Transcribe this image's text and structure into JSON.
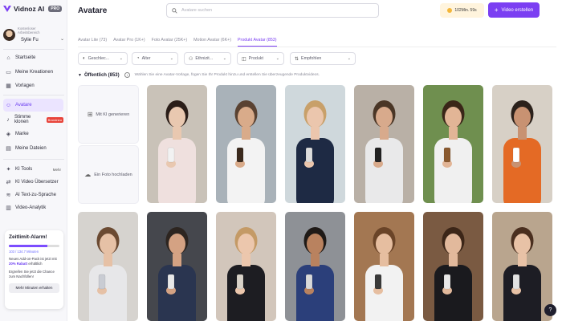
{
  "app": {
    "name": "Vidnoz AI",
    "plan_badge": "PRO"
  },
  "workspace": {
    "label": "Kostenloser Arbeitsbereich",
    "user_name": "Sylie Fu"
  },
  "sidebar": {
    "items": [
      {
        "label": "Startseite",
        "icon": "home-icon"
      },
      {
        "label": "Meine Kreationen",
        "icon": "folder-icon"
      },
      {
        "label": "Vorlagen",
        "icon": "template-icon"
      },
      {
        "label": "Avatare",
        "icon": "avatar-icon",
        "active": true
      },
      {
        "label": "Stimme klonen",
        "icon": "voice-icon",
        "badge": "Brandneu"
      },
      {
        "label": "Marke",
        "icon": "brand-icon"
      },
      {
        "label": "Meine Dateien",
        "icon": "files-icon"
      },
      {
        "label": "KI Tools",
        "icon": "ai-tools-icon",
        "extra": "Mehr"
      },
      {
        "label": "KI Video Übersetzer",
        "icon": "translate-icon"
      },
      {
        "label": "AI Text-zu-Sprache",
        "icon": "tts-icon"
      },
      {
        "label": "Video-Analytik",
        "icon": "analytics-icon"
      }
    ]
  },
  "promo": {
    "title": "Zeitlimit-Alarm!",
    "minutes": "103 / 134.7 Minuten",
    "progress": 0.765,
    "text_pre": "Neues Add-on-Pack ist jetzt mit ",
    "text_highlight": "20% Rabatt",
    "text_post": " erhältlich",
    "text2": "Ergreifen Sie jetzt die Chance zum Nachfüllen!",
    "button": "Mehr Minuten erhalten"
  },
  "header": {
    "title": "Avatare",
    "search_placeholder": "Avatare suchen",
    "credits": "102Min. 59s",
    "create_button": "Video erstellen"
  },
  "tabs": [
    {
      "label": "Avatar Lite (73)"
    },
    {
      "label": "Avatar Pro (1K+)"
    },
    {
      "label": "Foto Avatar (25K+)"
    },
    {
      "label": "Motion Avatar (6K+)"
    },
    {
      "label": "Produkt Avatar (853)",
      "active": true
    }
  ],
  "filters": {
    "gender": "Geschlec...",
    "age": "Alter",
    "ethnicity": "Ethnizit...",
    "product": "Produkt",
    "sort": "Empfohlen"
  },
  "section": {
    "title": "Öffentlich (853)",
    "description": "Wählen Sie eine Avatar-Vorlage, fügen Sie Ihr Produkt hinzu und erstellen Sie überzeugende Produktvideos."
  },
  "actions": {
    "generate": "Mit KI generieren",
    "upload": "Ein Foto hochladen"
  },
  "colors": {
    "accent": "#7b3ff2",
    "active_bg": "#ebe4ff"
  },
  "avatars": [
    {
      "name": "woman-lotion-bathrobe",
      "bg": "#c9c2b8",
      "skin": "#e9c8b0",
      "hair": "#2a1d18",
      "cloth": "#efe0de",
      "prop": "#f2f2f2"
    },
    {
      "name": "man-labcoat-jar",
      "bg": "#a9b2b9",
      "skin": "#d9ab8a",
      "hair": "#5a4232",
      "cloth": "#f3f3f3",
      "prop": "#3b2a1e"
    },
    {
      "name": "woman-blonde-spray",
      "bg": "#cfd8dc",
      "skin": "#ebc6ad",
      "hair": "#c8a06a",
      "cloth": "#1e2a44",
      "prop": "#dcdcdc"
    },
    {
      "name": "man-phone",
      "bg": "#b9b0a6",
      "skin": "#d8aa8c",
      "hair": "#4a3626",
      "cloth": "#e9e9ea",
      "prop": "#222"
    },
    {
      "name": "woman-outdoor-jar",
      "bg": "#6f8f4f",
      "skin": "#e2b596",
      "hair": "#3a2618",
      "cloth": "#f0f0f0",
      "prop": "#8a5a30"
    },
    {
      "name": "man-orange-shirt",
      "bg": "#d7d0c6",
      "skin": "#c89272",
      "hair": "#2b211b",
      "cloth": "#e46a25",
      "prop": "#ffffff"
    },
    {
      "name": "woman-bottle-grey",
      "bg": "#d6d3cf",
      "skin": "#e6c1a6",
      "hair": "#6b4a32",
      "cloth": "#e7e7e9",
      "prop": "#c9ccd3"
    },
    {
      "name": "man-suit-car",
      "bg": "#45474d",
      "skin": "#d4a283",
      "hair": "#2d2520",
      "cloth": "#2a3550",
      "prop": "#e8e8e8"
    },
    {
      "name": "woman-blonde-black",
      "bg": "#d2c6bb",
      "skin": "#ecc7ad",
      "hair": "#c49a66",
      "cloth": "#1d1d22",
      "prop": "#d8d2c8"
    },
    {
      "name": "man-gym",
      "bg": "#8e9196",
      "skin": "#b9825f",
      "hair": "#1f1a17",
      "cloth": "#2b3f7a",
      "prop": "#d9d9d9"
    },
    {
      "name": "woman-kitchen-pot",
      "bg": "#a37752",
      "skin": "#e6bea0",
      "hair": "#6a4428",
      "cloth": "#f2f2f2",
      "prop": "#3a3a3a"
    },
    {
      "name": "woman-restaurant",
      "bg": "#7a5a42",
      "skin": "#e2b99c",
      "hair": "#3c2618",
      "cloth": "#1a1a1e",
      "prop": "#e8e8e8"
    },
    {
      "name": "woman-dark-sweater",
      "bg": "#b9a58e",
      "skin": "#e8c2a6",
      "hair": "#4a2f1f",
      "cloth": "#1d1d24",
      "prop": "#e2e2e2"
    }
  ]
}
